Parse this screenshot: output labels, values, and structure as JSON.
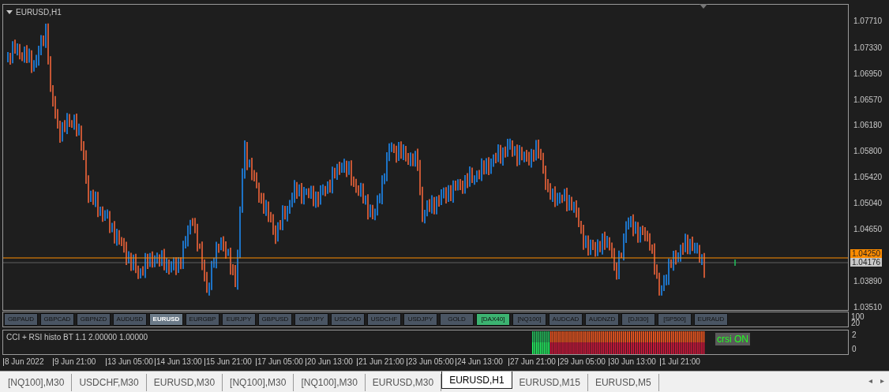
{
  "chart": {
    "title": "EURUSD,H1",
    "price_ticks": [
      "1.07710",
      "1.07330",
      "1.06950",
      "1.06570",
      "1.06180",
      "1.05800",
      "1.05420",
      "1.05040",
      "1.04650",
      "1.03890",
      "1.03510"
    ],
    "ask_label": "1.04250",
    "bid_label": "1.04176"
  },
  "symbol_buttons": [
    {
      "label": "GBPAUD",
      "selected": false,
      "highlighted": false
    },
    {
      "label": "GBPCAD",
      "selected": false,
      "highlighted": false
    },
    {
      "label": "GBPNZD",
      "selected": false,
      "highlighted": false
    },
    {
      "label": "AUDUSD",
      "selected": false,
      "highlighted": false
    },
    {
      "label": "EURUSD",
      "selected": true,
      "highlighted": false
    },
    {
      "label": "EURGBP",
      "selected": false,
      "highlighted": false
    },
    {
      "label": "EURJPY",
      "selected": false,
      "highlighted": false
    },
    {
      "label": "GBPUSD",
      "selected": false,
      "highlighted": false
    },
    {
      "label": "GBPJPY",
      "selected": false,
      "highlighted": false
    },
    {
      "label": "USDCAD",
      "selected": false,
      "highlighted": false
    },
    {
      "label": "USDCHF",
      "selected": false,
      "highlighted": false
    },
    {
      "label": "USDJPY",
      "selected": false,
      "highlighted": false
    },
    {
      "label": "GOLD",
      "selected": false,
      "highlighted": false
    },
    {
      "label": "[DAX40]",
      "selected": false,
      "highlighted": true
    },
    {
      "label": "[NQ100]",
      "selected": false,
      "highlighted": false
    },
    {
      "label": "AUDCAD",
      "selected": false,
      "highlighted": false
    },
    {
      "label": "AUDNZD",
      "selected": false,
      "highlighted": false
    },
    {
      "label": "[DJI30]",
      "selected": false,
      "highlighted": false
    },
    {
      "label": "[SP500]",
      "selected": false,
      "highlighted": false
    },
    {
      "label": "EURAUD",
      "selected": false,
      "highlighted": false
    }
  ],
  "button_panel_ticks": [
    "100",
    "20"
  ],
  "indicator": {
    "title": "CCI + RSI histo BT 1.1 2.00000 1.00000",
    "toggle": "crsi ON",
    "ticks": [
      "2",
      "0"
    ]
  },
  "time_ticks": [
    "8 Jun 2022",
    "9 Jun 21:00",
    "13 Jun 05:00",
    "14 Jun 13:00",
    "15 Jun 21:00",
    "17 Jun 05:00",
    "20 Jun 13:00",
    "21 Jun 21:00",
    "23 Jun 05:00",
    "24 Jun 13:00",
    "27 Jun 21:00",
    "29 Jun 05:00",
    "30 Jun 13:00",
    "1 Jul 21:00"
  ],
  "tabs": [
    {
      "label": "[NQ100],M30",
      "selected": false
    },
    {
      "label": "USDCHF,M30",
      "selected": false
    },
    {
      "label": "EURUSD,M30",
      "selected": false
    },
    {
      "label": "[NQ100],M30",
      "selected": false
    },
    {
      "label": "[NQ100],M30",
      "selected": false
    },
    {
      "label": "EURUSD,M30",
      "selected": false
    },
    {
      "label": "EURUSD,H1",
      "selected": true
    },
    {
      "label": "EURUSD,M15",
      "selected": false
    },
    {
      "label": "EURUSD,M5",
      "selected": false
    }
  ],
  "tab_scroll": [
    "◂",
    "▸"
  ]
}
